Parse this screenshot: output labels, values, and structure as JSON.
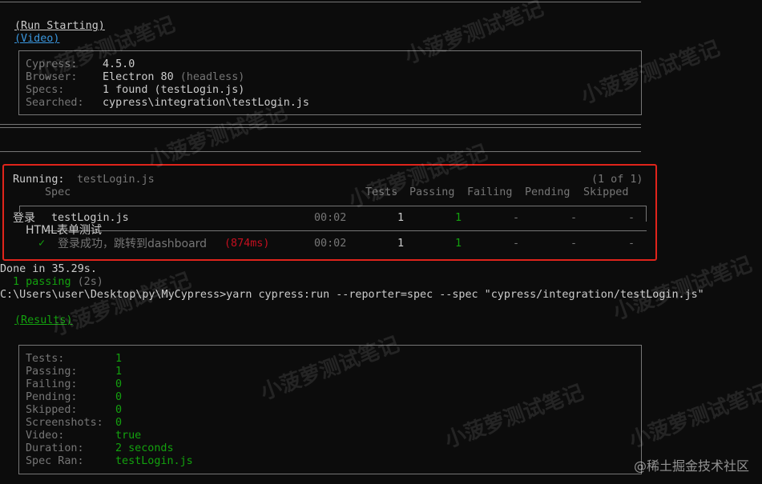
{
  "header": {
    "run_starting": "(Run Starting)",
    "video": "(Video)"
  },
  "run_info": [
    {
      "key": "Cypress:",
      "value": "4.5.0",
      "suffix": ""
    },
    {
      "key": "Browser:",
      "value": "Electron 80 ",
      "suffix": "(headless)"
    },
    {
      "key": "Specs:",
      "value": "1 found (testLogin.js)",
      "suffix": ""
    },
    {
      "key": "Searched:",
      "value": "cypress\\integration\\testLogin.js",
      "suffix": ""
    }
  ],
  "running": {
    "label": "Running:",
    "spec": "testLogin.js",
    "count": "(1 of 1)"
  },
  "table": {
    "headers": {
      "spec": "Spec",
      "tests": "Tests",
      "passing": "Passing",
      "failing": "Failing",
      "pending": "Pending",
      "skipped": "Skipped"
    },
    "row": {
      "suite": "登录",
      "spec": "testLogin.js",
      "time": "00:02",
      "tests": "1",
      "passing": "1",
      "failing": "-",
      "pending": "-",
      "skipped": "-"
    },
    "sub_suite": "HTML表单测试",
    "test": {
      "check": "✓",
      "title": "登录成功，跳转到dashboard",
      "duration": "(874ms)",
      "time": "00:02",
      "tests": "1",
      "passing": "1",
      "failing": "-",
      "pending": "-",
      "skipped": "-"
    }
  },
  "done": "Done in 35.29s.",
  "passing_summary": {
    "count": "1 passing",
    "time": "(2s)"
  },
  "prompt": {
    "path": "C:\\Users\\user\\Desktop\\py\\MyCypress>",
    "command": "yarn cypress:run --reporter=spec --spec \"cypress/integration/testLogin.js\""
  },
  "results_label": "(Results)",
  "results": [
    {
      "key": "Tests:",
      "value": "1"
    },
    {
      "key": "Passing:",
      "value": "1"
    },
    {
      "key": "Failing:",
      "value": "0"
    },
    {
      "key": "Pending:",
      "value": "0"
    },
    {
      "key": "Skipped:",
      "value": "0"
    },
    {
      "key": "Screenshots:",
      "value": "0"
    },
    {
      "key": "Video:",
      "value": "true"
    },
    {
      "key": "Duration:",
      "value": "2 seconds"
    },
    {
      "key": "Spec Ran:",
      "value": "testLogin.js"
    }
  ],
  "watermark": "小菠萝测试笔记",
  "credit": "@稀土掘金技术社区"
}
